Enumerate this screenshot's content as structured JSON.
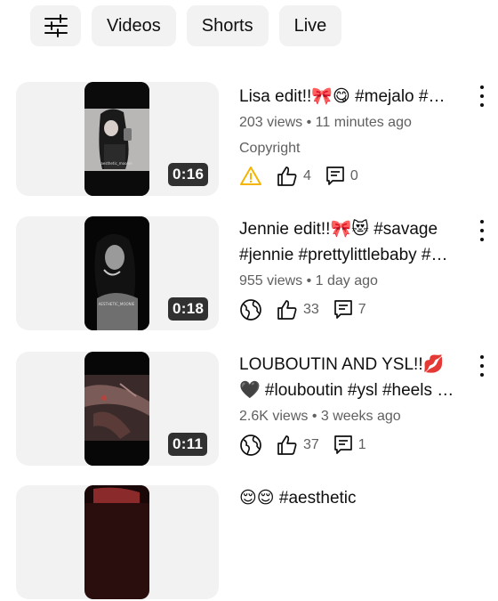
{
  "filters": {
    "chips": [
      "Videos",
      "Shorts",
      "Live"
    ]
  },
  "videos": [
    {
      "title": "Lisa edit!!🎀😋 #mejalo #…",
      "meta": "203 views • 11 minutes ago",
      "copyright": "Copyright",
      "duration": "0:16",
      "likes": "4",
      "comments": "0",
      "visibility_icon": "warning-icon",
      "thumb_caption": "aesthetic_moonie"
    },
    {
      "title": "Jennie edit!!🎀😻 #savage\n#jennie #prettylittlebaby #…",
      "meta": "955 views • 1 day ago",
      "duration": "0:18",
      "likes": "33",
      "comments": "7",
      "visibility_icon": "globe-icon",
      "thumb_caption": "AESTHETIC_MOONIE"
    },
    {
      "title": "LOUBOUTIN AND YSL!!💋\n🖤 #louboutin #ysl #heels …",
      "meta": "2.6K views • 3 weeks ago",
      "duration": "0:11",
      "likes": "37",
      "comments": "1",
      "visibility_icon": "globe-icon"
    },
    {
      "title": "😌😌 #aesthetic"
    }
  ],
  "colors": {
    "accent_warning": "#f4b400",
    "chip_bg": "#f2f2f2",
    "secondary_text": "#606060"
  }
}
